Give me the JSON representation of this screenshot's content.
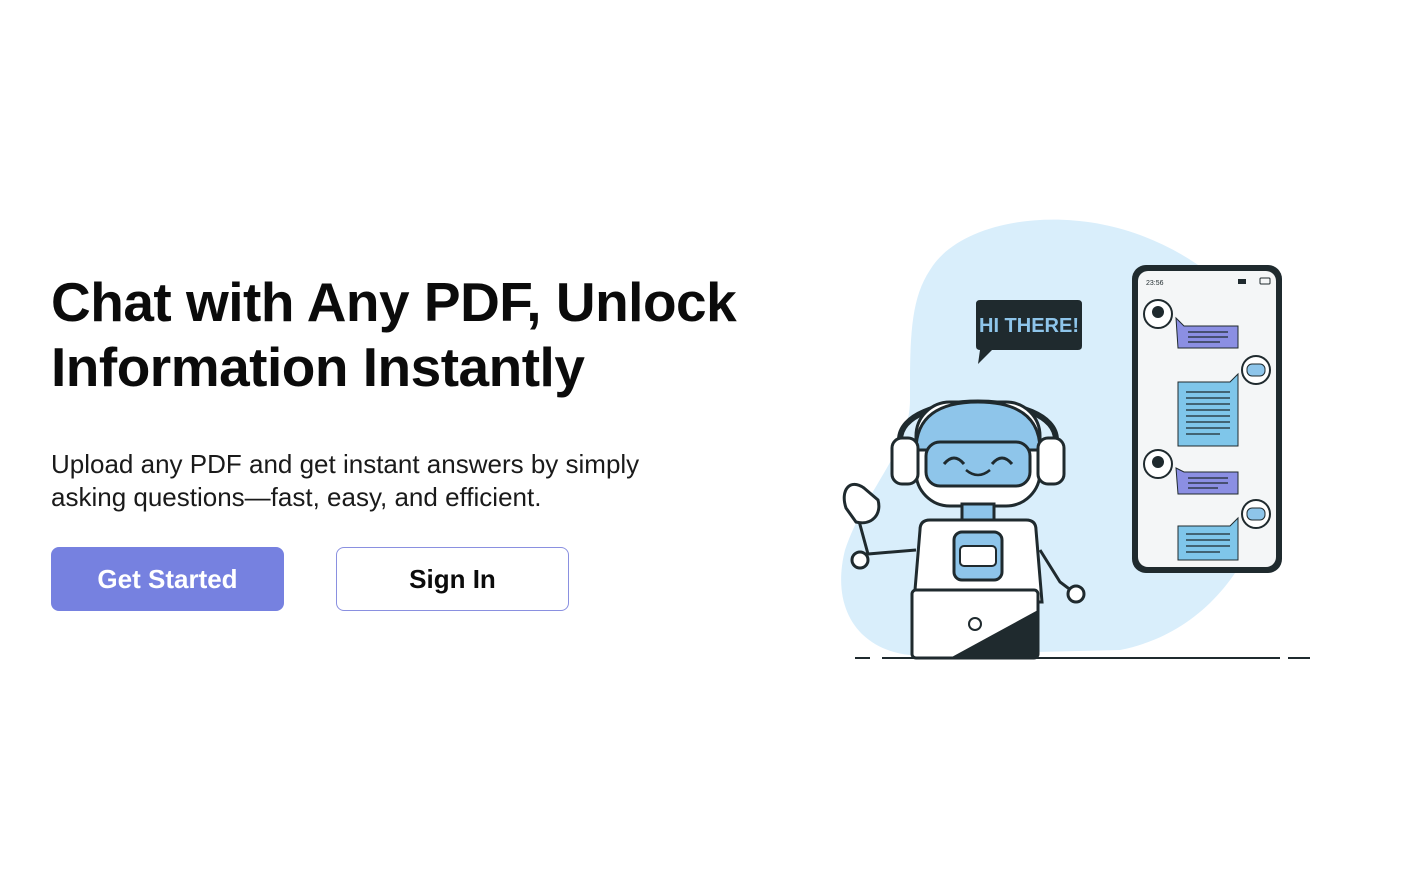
{
  "hero": {
    "headline": "Chat with Any PDF, Unlock Information Instantly",
    "subhead": "Upload any PDF and get instant answers by simply asking questions—fast, easy, and efficient."
  },
  "buttons": {
    "get_started": "Get Started",
    "sign_in": "Sign In"
  },
  "illustration": {
    "speech_bubble": "HI THERE!",
    "phone_time": "23:56",
    "colors": {
      "blob": "#d9eefb",
      "robot_blue": "#8ec5ea",
      "chat_purple": "#8b8fe3",
      "chat_blue": "#7fc6ea",
      "outline": "#1f2a2e"
    }
  },
  "theme": {
    "accent": "#7681e0",
    "secondary_border": "#8a90e0"
  }
}
